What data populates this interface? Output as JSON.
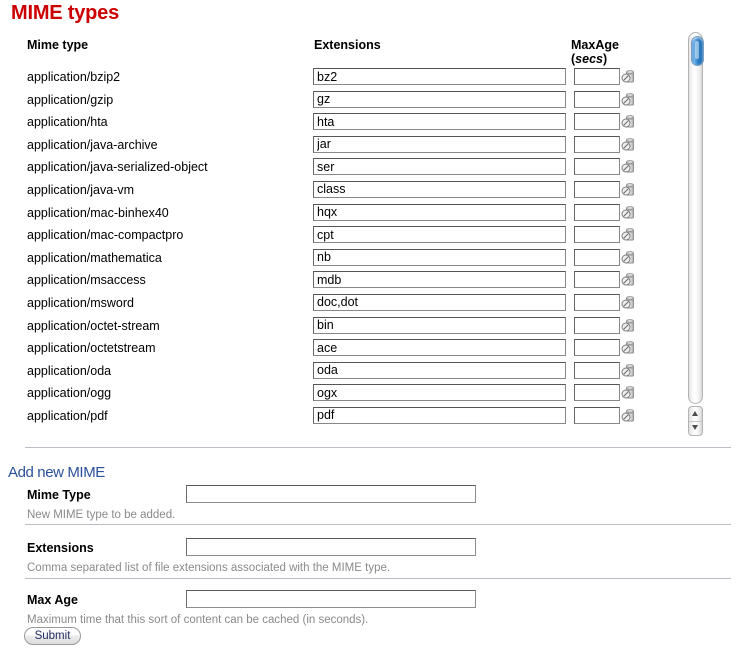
{
  "page": {
    "title": "MIME types",
    "title_color": "#cc0000"
  },
  "table": {
    "headers": {
      "mime_type": "Mime type",
      "extensions": "Extensions",
      "maxage_line1": "MaxAge",
      "maxage_line2": "secs"
    },
    "rows": [
      {
        "mime_type": "application/bzip2",
        "extensions": "bz2",
        "maxage": ""
      },
      {
        "mime_type": "application/gzip",
        "extensions": "gz",
        "maxage": ""
      },
      {
        "mime_type": "application/hta",
        "extensions": "hta",
        "maxage": ""
      },
      {
        "mime_type": "application/java-archive",
        "extensions": "jar",
        "maxage": ""
      },
      {
        "mime_type": "application/java-serialized-object",
        "extensions": "ser",
        "maxage": ""
      },
      {
        "mime_type": "application/java-vm",
        "extensions": "class",
        "maxage": ""
      },
      {
        "mime_type": "application/mac-binhex40",
        "extensions": "hqx",
        "maxage": ""
      },
      {
        "mime_type": "application/mac-compactpro",
        "extensions": "cpt",
        "maxage": ""
      },
      {
        "mime_type": "application/mathematica",
        "extensions": "nb",
        "maxage": ""
      },
      {
        "mime_type": "application/msaccess",
        "extensions": "mdb",
        "maxage": ""
      },
      {
        "mime_type": "application/msword",
        "extensions": "doc,dot",
        "maxage": ""
      },
      {
        "mime_type": "application/octet-stream",
        "extensions": "bin",
        "maxage": ""
      },
      {
        "mime_type": "application/octetstream",
        "extensions": "ace",
        "maxage": ""
      },
      {
        "mime_type": "application/oda",
        "extensions": "oda",
        "maxage": ""
      },
      {
        "mime_type": "application/ogg",
        "extensions": "ogx",
        "maxage": ""
      },
      {
        "mime_type": "application/pdf",
        "extensions": "pdf",
        "maxage": ""
      }
    ],
    "row_action_icon": "delete-icon"
  },
  "scrollbar": {
    "up_arrow_icon": "arrow-up-icon",
    "down_arrow_icon": "arrow-down-icon",
    "thumb_color": "#2f7fc6",
    "position": "top"
  },
  "add_form": {
    "section_title": "Add new MIME",
    "section_title_color": "#2a4f9a",
    "fields": [
      {
        "label": "Mime Type",
        "value": "",
        "description": "New MIME type to be added."
      },
      {
        "label": "Extensions",
        "value": "",
        "description": "Comma separated list of file extensions associated with the MIME type."
      },
      {
        "label": "Max Age",
        "value": "",
        "description": "Maximum time that this sort of content can be cached (in seconds)."
      }
    ],
    "submit_label": "Submit"
  }
}
